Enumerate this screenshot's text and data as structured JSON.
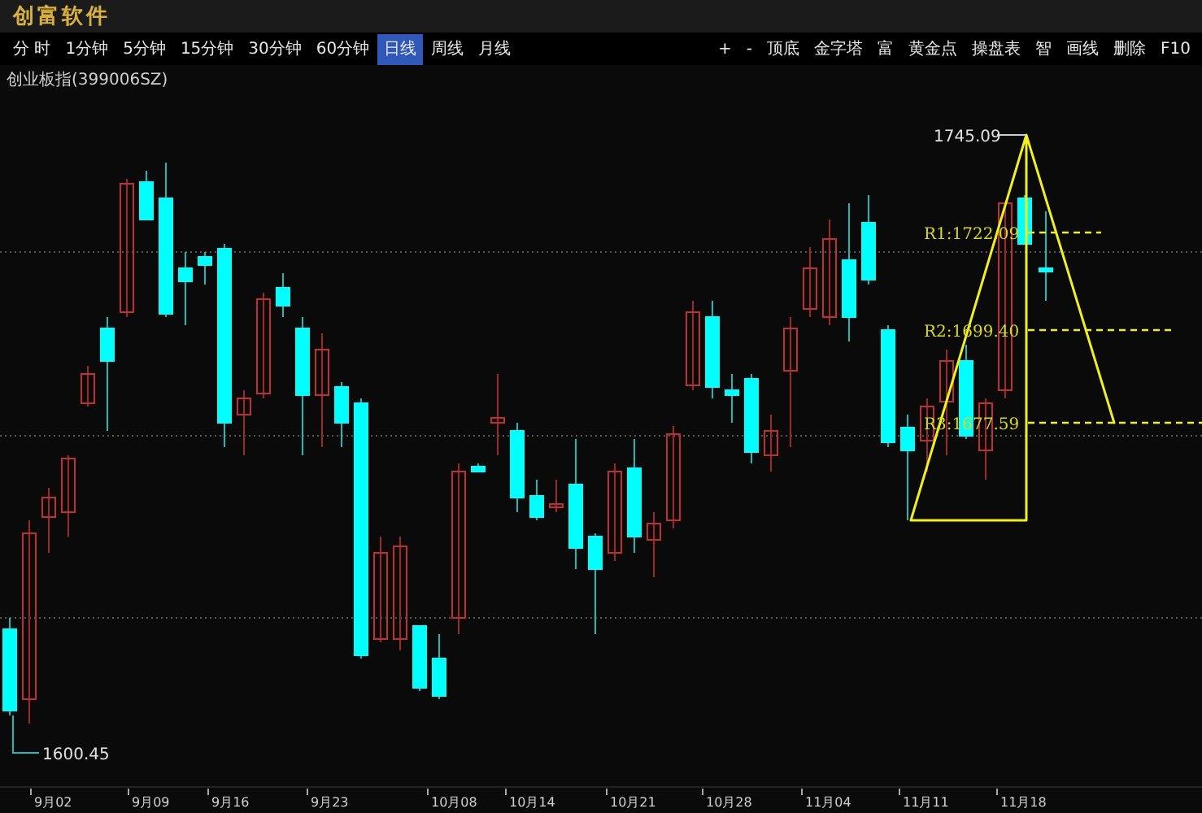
{
  "window": {
    "title": "创富软件"
  },
  "periods": [
    {
      "label": "分 时",
      "selected": false
    },
    {
      "label": "1分钟",
      "selected": false
    },
    {
      "label": "5分钟",
      "selected": false
    },
    {
      "label": "15分钟",
      "selected": false
    },
    {
      "label": "30分钟",
      "selected": false
    },
    {
      "label": "60分钟",
      "selected": false
    },
    {
      "label": "日线",
      "selected": true
    },
    {
      "label": "周线",
      "selected": false
    },
    {
      "label": "月线",
      "selected": false
    }
  ],
  "tools": [
    "+",
    "-",
    "顶底",
    "金字塔",
    "富",
    "黄金点",
    "操盘表",
    "智",
    "画线",
    "删除",
    "F10"
  ],
  "stock_name": "创业板指(399006SZ)",
  "chart": {
    "high_label": "1745.09",
    "low_label": "1600.45",
    "levels": [
      "R1:1722.09",
      "R2:1699.40",
      "R3:1677.59"
    ],
    "x_labels": [
      "9月02",
      "9月09",
      "9月16",
      "9月23",
      "10月08",
      "10月14",
      "10月21",
      "10月28",
      "11月04",
      "11月11",
      "11月18"
    ]
  }
}
